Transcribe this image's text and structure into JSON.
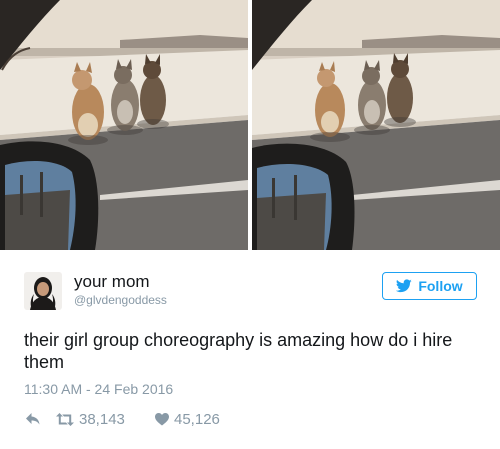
{
  "user": {
    "display_name": "your mom",
    "handle": "@glvdengoddess"
  },
  "follow_button": {
    "label": "Follow",
    "icon": "twitter-bird-icon"
  },
  "tweet": {
    "text": "their girl group choreography is amazing how do i hire them",
    "timestamp": "11:30 AM - 24 Feb 2016"
  },
  "actions": {
    "reply_icon": "reply-arrow-icon",
    "retweet_icon": "retweet-icon",
    "retweet_count": "38,143",
    "like_icon": "heart-icon",
    "like_count": "45,126"
  },
  "media": [
    {
      "subject": "three cats standing on hind legs beside a wall, seen from car window"
    },
    {
      "subject": "three cats in changed poses beside the wall, seen from car window"
    }
  ],
  "colors": {
    "accent": "#1da1f2",
    "muted": "#8899a6",
    "text": "#14171a"
  }
}
